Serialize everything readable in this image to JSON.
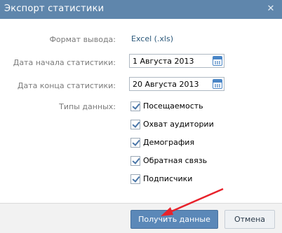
{
  "dialog": {
    "title": "Экспорт статистики"
  },
  "form": {
    "format_label": "Формат вывода:",
    "format_value": "Excel (.xls)",
    "start_label": "Дата начала статистики:",
    "start_value": "1 Августа 2013",
    "end_label": "Дата конца статистики:",
    "end_value": "20 Августа 2013",
    "types_label": "Типы данных:",
    "types": [
      {
        "label": "Посещаемость",
        "checked": true
      },
      {
        "label": "Охват аудитории",
        "checked": true
      },
      {
        "label": "Демография",
        "checked": true
      },
      {
        "label": "Обратная связь",
        "checked": true
      },
      {
        "label": "Подписчики",
        "checked": true
      }
    ]
  },
  "footer": {
    "submit_label": "Получить данные",
    "cancel_label": "Отмена"
  },
  "colors": {
    "title_bar": "#5f86ac",
    "primary_button": "#5b88b8",
    "link": "#2b587a",
    "annotation_arrow": "#e8222b"
  },
  "icons": {
    "close": "close-icon",
    "calendar": "calendar-icon",
    "checkbox": "checkmark"
  }
}
